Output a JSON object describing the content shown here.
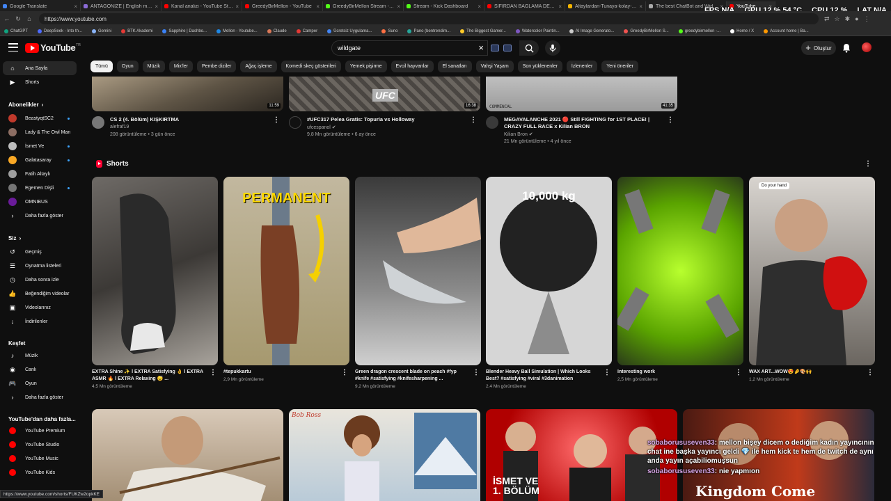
{
  "browser": {
    "tabs": [
      {
        "label": "Google Translate",
        "color": "#4285f4"
      },
      {
        "label": "ANTAGONIZE | English meaning",
        "color": "#8b6bd6"
      },
      {
        "label": "Kanal analizi - YouTube Studio",
        "color": "#ff0000"
      },
      {
        "label": "GreedyBirMellon - YouTube",
        "color": "#ff0000"
      },
      {
        "label": "GreedyBirMellon Stream - Watch",
        "color": "#53fc18"
      },
      {
        "label": "Stream - Kick Dashboard",
        "color": "#53fc18"
      },
      {
        "label": "SIFIRDAN BAĞLAMA DERSLERİ",
        "color": "#ff0000"
      },
      {
        "label": "Altaylardan-Tunaya-kolay-nota-",
        "color": "#f4b400"
      },
      {
        "label": "The best ChatBot and Widgets f",
        "color": "#aaaaaa"
      },
      {
        "label": "YouTube",
        "color": "#ff0000",
        "active": true
      }
    ],
    "url": "https://www.youtube.com",
    "bookmarks": [
      {
        "label": "ChatGPT",
        "color": "#10a37f"
      },
      {
        "label": "DeepSeek - Into th...",
        "color": "#4d6bfe"
      },
      {
        "label": "Gemini",
        "color": "#8ab4f8"
      },
      {
        "label": "BTK Akademi",
        "color": "#e53935"
      },
      {
        "label": "Sapphire | Dashbo...",
        "color": "#3b82f6"
      },
      {
        "label": "Mellon - Youtube...",
        "color": "#1e88e5"
      },
      {
        "label": "Claude",
        "color": "#d97757"
      },
      {
        "label": "Camper",
        "color": "#e53935"
      },
      {
        "label": "Ücretsiz Uygulama...",
        "color": "#4285f4"
      },
      {
        "label": "Suno",
        "color": "#ff7043"
      },
      {
        "label": "Pano (bentrendim...",
        "color": "#26a69a"
      },
      {
        "label": "The Biggest Gamer...",
        "color": "#ffca28"
      },
      {
        "label": "Watercolor Paintin...",
        "color": "#7e57c2"
      },
      {
        "label": "AI Image Generato...",
        "color": "#cccccc"
      },
      {
        "label": "GreedyBirMellon S...",
        "color": "#ef5350"
      },
      {
        "label": "greedybirmellon -...",
        "color": "#53fc18"
      },
      {
        "label": "Home / X",
        "color": "#ffffff"
      },
      {
        "label": "Account home | Ba...",
        "color": "#ff9800"
      }
    ]
  },
  "overlay_stats": {
    "fps_label": "FPS",
    "fps_value": "N/A",
    "gpu_label": "GPU",
    "gpu_value": "12 % 54 °C",
    "cpu_label": "CPU",
    "cpu_value": "12 %",
    "lat_label": "LAT",
    "lat_value": "N/A"
  },
  "header": {
    "logo": "YouTube",
    "region": "TR",
    "search_value": "wildgate",
    "create_label": "Oluştur"
  },
  "sidebar": {
    "main": [
      {
        "label": "Ana Sayfa",
        "icon": "home-icon",
        "active": true
      },
      {
        "label": "Shorts",
        "icon": "shorts-icon"
      }
    ],
    "subs_title": "Abonelikler",
    "subs": [
      {
        "label": "BeastyqtSC2",
        "color": "#c0392b",
        "live": true
      },
      {
        "label": "Lady & The Owl Man",
        "color": "#8d6e63",
        "live": false
      },
      {
        "label": "İsmet Ve",
        "color": "#bdbdbd",
        "live": true
      },
      {
        "label": "Galatasaray",
        "color": "#f9a825",
        "live": true
      },
      {
        "label": "Fatih Altaylı",
        "color": "#9e9e9e",
        "live": false
      },
      {
        "label": "Egemen Dişli",
        "color": "#757575",
        "live": true
      },
      {
        "label": "OMNIBUS",
        "color": "#6a1b9a",
        "live": false
      }
    ],
    "subs_more": "Daha fazla göster",
    "you_title": "Siz",
    "you": [
      {
        "label": "Geçmiş",
        "icon": "history-icon"
      },
      {
        "label": "Oynatma listeleri",
        "icon": "playlist-icon"
      },
      {
        "label": "Daha sonra izle",
        "icon": "watch-later-icon"
      },
      {
        "label": "Beğendiğim videolar",
        "icon": "like-icon"
      },
      {
        "label": "Videolarınız",
        "icon": "your-videos-icon"
      },
      {
        "label": "İndirilenler",
        "icon": "download-icon"
      }
    ],
    "explore_title": "Keşfet",
    "explore": [
      {
        "label": "Müzik",
        "icon": "music-icon"
      },
      {
        "label": "Canlı",
        "icon": "live-icon"
      },
      {
        "label": "Oyun",
        "icon": "gaming-icon"
      }
    ],
    "explore_more": "Daha fazla göster",
    "more_title": "YouTube'dan daha fazla...",
    "more": [
      {
        "label": "YouTube Premium"
      },
      {
        "label": "YouTube Studio"
      },
      {
        "label": "YouTube Music"
      },
      {
        "label": "YouTube Kids"
      }
    ]
  },
  "chips": [
    "Tümü",
    "Oyun",
    "Müzik",
    "Mix'ler",
    "Pembe diziler",
    "Ağaç işleme",
    "Komedi skeç gösterileri",
    "Yemek pişirme",
    "Evcil hayvanlar",
    "El sanatları",
    "Vahşi Yaşam",
    "Son yüklenenler",
    "İzlenenler",
    "Yeni öneriler"
  ],
  "videos_top": [
    {
      "title": "CS 2 (4. Bölüm) KIŞKIRTMA",
      "channel": "alefraf19",
      "stats": "208 görüntüleme • 3 gün önce",
      "duration": "11:59"
    },
    {
      "title": "#UFC317 Pelea Gratis: Topuria vs Holloway",
      "channel": "ufcespanol ✔",
      "stats": "9,8 Mn görüntüleme • 6 ay önce",
      "duration": "16:38",
      "thumb_text": "UFC"
    },
    {
      "title": "MEGAVALANCHE 2021 🔴 Still FIGHTING for 1ST PLACE! | CRAZY FULL RACE x Kilian BRON",
      "channel": "Kilian Bron ✔",
      "stats": "21 Mn görüntüleme • 4 yıl önce",
      "duration": "41:35",
      "thumb_text": "COMMENCAL"
    }
  ],
  "shorts_title": "Shorts",
  "shorts": [
    {
      "title": "EXTRA Shine ✨ l EXTRA Satisfying 👌 l EXTRA ASMR 🔥 l EXTRA Relaxing 😴 ...",
      "views": "4,5 Mn görüntüleme"
    },
    {
      "title": "#tepukkartu",
      "views": "2,9 Mn görüntüleme",
      "overlay": "PERMANENT"
    },
    {
      "title": "Green dragon crescent blade on peach #fyp #knife #satisfying #knifesharpening ...",
      "views": "9,2 Mn görüntüleme"
    },
    {
      "title": "Blender Heavy Ball Simulation | Which Looks Best? #satisfying #viral #3danimation",
      "views": "2,4 Mn görüntüleme",
      "overlay": "10,000 kg"
    },
    {
      "title": "Interesting work",
      "views": "2,5 Mn görüntüleme"
    },
    {
      "title": "WAX ART...WOW😍🤌🎨🙌",
      "views": "1,2 Mn görüntüleme",
      "overlay": "Do your hand"
    }
  ],
  "bottom_thumbs": [
    {
      "text": ""
    },
    {
      "text": "Bob Ross"
    },
    {
      "text": "İSMET VE\n1. BÖLÜM"
    },
    {
      "text": "Kingdom Come"
    }
  ],
  "status_url": "https://www.youtube.com/shorts/FUKZw2opkKE",
  "chat": [
    {
      "user": "sobaborususeven33",
      "msg": ": mellon bişey dicem o dediğim kadın yayıncının chat ine başka yayıncı geldi 💎 ile hem kick te hem de twitch de aynı anda yayın açabiliomuşsun"
    },
    {
      "user": "sobaborususeven33",
      "msg": ": nie yapmıon"
    }
  ]
}
